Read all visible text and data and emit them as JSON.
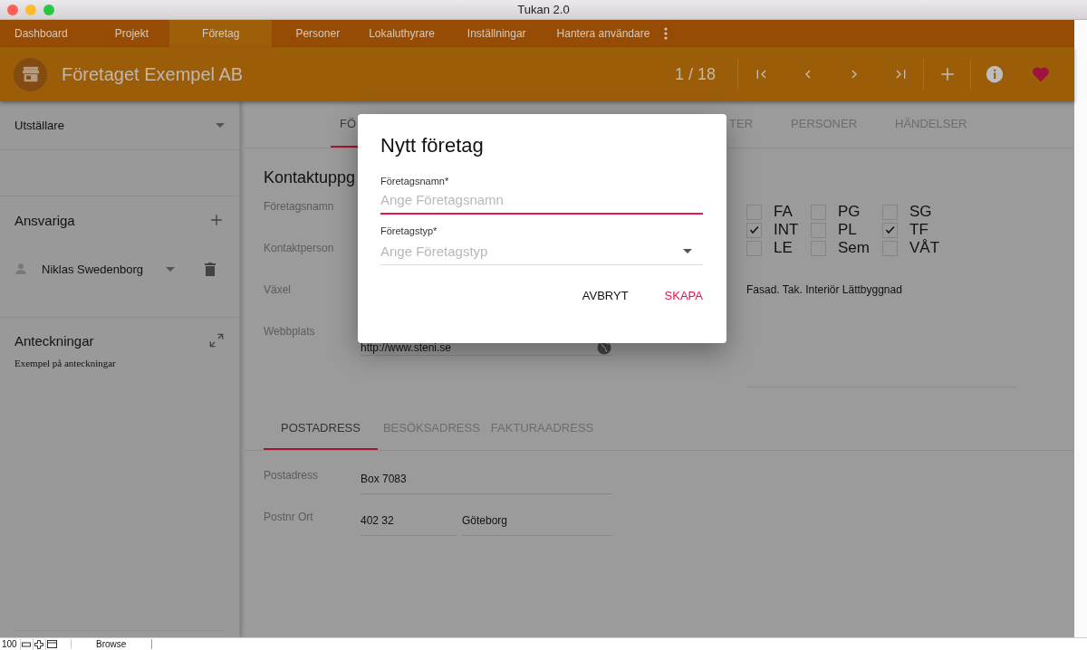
{
  "window": {
    "title": "Tukan 2.0"
  },
  "nav": [
    {
      "label": "Dashboard",
      "selected": false
    },
    {
      "label": "Projekt",
      "selected": false
    },
    {
      "label": "Företag",
      "selected": true
    },
    {
      "label": "Personer",
      "selected": false
    },
    {
      "label": "Lokaluthyrare",
      "selected": false
    },
    {
      "label": "Inställningar",
      "selected": false
    },
    {
      "label": "Hantera användare",
      "selected": false
    }
  ],
  "header": {
    "title": "Företaget Exempel AB",
    "counter": "1 / 18"
  },
  "sidebar": {
    "category": "Utställare",
    "responsible_title": "Ansvariga",
    "people": [
      {
        "name": "Niklas Swedenborg"
      }
    ],
    "notes_title": "Anteckningar",
    "notes": "Exempel på anteckningar"
  },
  "tabs": [
    {
      "label": "FÖ",
      "selected": true
    },
    {
      "label": "TER",
      "selected": false
    },
    {
      "label": "PERSONER",
      "selected": false
    },
    {
      "label": "HÄNDELSER",
      "selected": false
    }
  ],
  "contact": {
    "heading": "Kontaktuppg",
    "fields": [
      {
        "label": "Företagsnamn"
      },
      {
        "label": "Kontaktperson"
      },
      {
        "label": "Växel"
      },
      {
        "label": "Webbplats",
        "value": "http://www.steni.se"
      }
    ]
  },
  "categories": [
    {
      "label": "FA",
      "checked": false
    },
    {
      "label": "PG",
      "checked": false
    },
    {
      "label": "SG",
      "checked": false
    },
    {
      "label": "INT",
      "checked": true
    },
    {
      "label": "PL",
      "checked": false
    },
    {
      "label": "TF",
      "checked": true
    },
    {
      "label": "LE",
      "checked": false
    },
    {
      "label": "Sem",
      "checked": false
    },
    {
      "label": "VÅT",
      "checked": false
    }
  ],
  "description": "Fasad. Tak. Interiör Lättbyggnad",
  "address_tabs": [
    {
      "label": "POSTADRESS",
      "selected": true
    },
    {
      "label": "BESÖKSADRESS",
      "selected": false
    },
    {
      "label": "FAKTURAADRESS",
      "selected": false
    }
  ],
  "address": [
    {
      "label": "Postadress",
      "values": [
        "Box 7083"
      ]
    },
    {
      "label": "Postnr Ort",
      "values": [
        "402 32",
        "Göteborg"
      ]
    }
  ],
  "dialog": {
    "title": "Nytt företag",
    "fields": [
      {
        "kind": "text",
        "label": "Företagsnamn*",
        "placeholder": "Ange Företagsnamn",
        "focused": true
      },
      {
        "kind": "select",
        "label": "Företagstyp*",
        "placeholder": "Ange Företagstyp",
        "focused": false
      }
    ],
    "buttons": [
      {
        "label": "AVBRYT",
        "primary": false
      },
      {
        "label": "SKAPA",
        "primary": true
      }
    ]
  },
  "status_bar": {
    "zoom": "100",
    "mode": "Browse"
  }
}
